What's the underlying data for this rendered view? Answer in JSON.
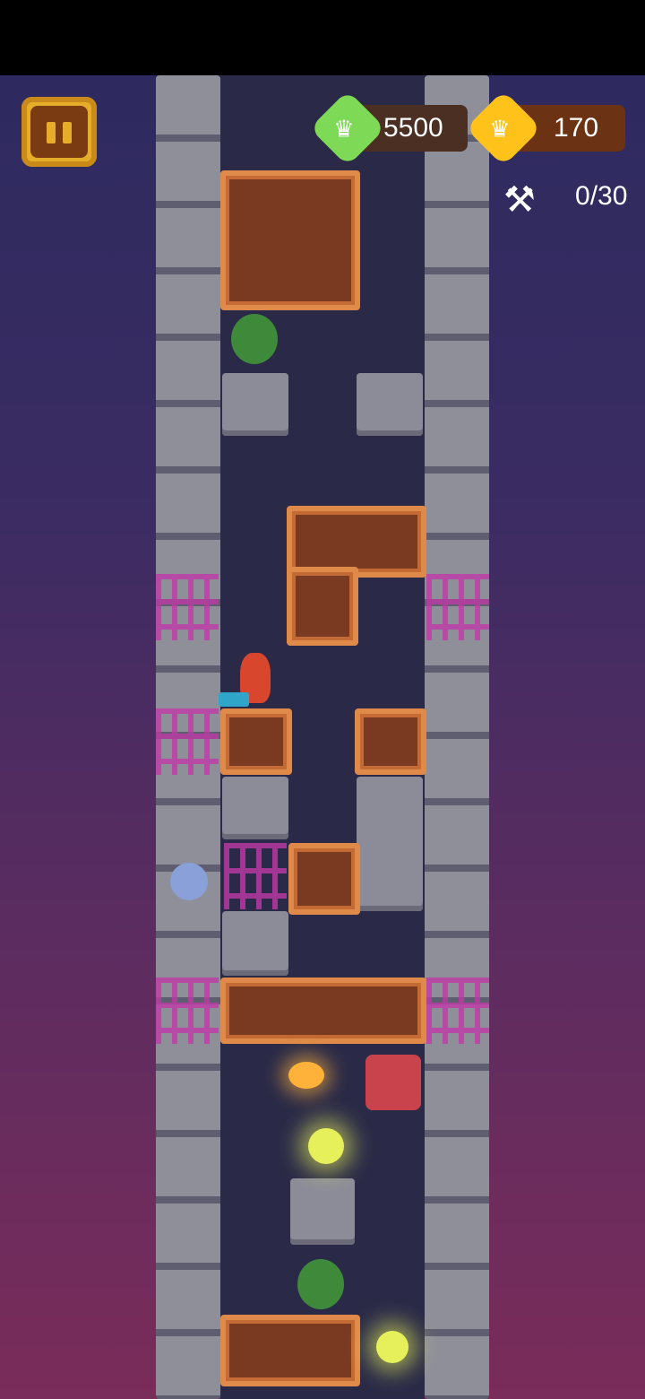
{
  "hud": {
    "score": "5500",
    "coins": "170",
    "smash_count": "0",
    "smash_total": "30",
    "icons": [
      "pause-icon",
      "crown-icon",
      "crown-icon",
      "hammer-icon"
    ]
  },
  "colors": {
    "score_gem": "#7ed957",
    "coin_gem": "#ffc21a",
    "brick_border": "#e08a4a",
    "background_top": "#2b2a5e",
    "background_bottom": "#7a2c5a"
  }
}
